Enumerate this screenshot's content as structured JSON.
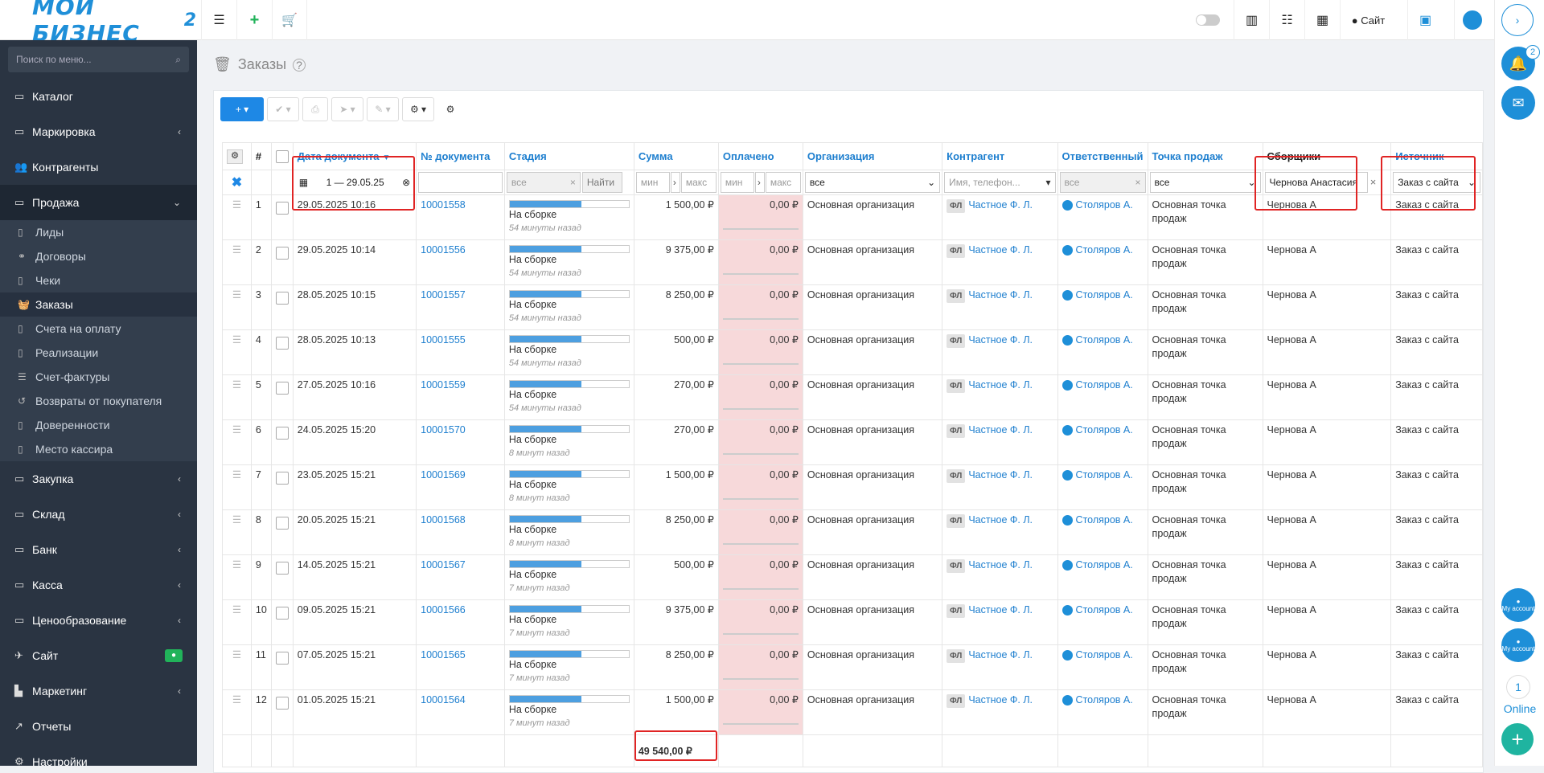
{
  "app": {
    "logo_main": "МОЙ БИЗНЕС",
    "logo_number": "2"
  },
  "topbar": {
    "site_label": "Сайт"
  },
  "sidebar": {
    "search_placeholder": "Поиск по меню...",
    "items": [
      {
        "label": "Каталог",
        "icon": "folder-icon",
        "arrow": false
      },
      {
        "label": "Маркировка",
        "icon": "folder-icon",
        "arrow": true
      },
      {
        "label": "Контрагенты",
        "icon": "users-icon",
        "arrow": false
      },
      {
        "label": "Продажа",
        "icon": "folder-icon",
        "arrow": true,
        "open": true
      }
    ],
    "sub_items": [
      {
        "label": "Лиды",
        "icon": "doc-icon"
      },
      {
        "label": "Договоры",
        "icon": "handshake-icon"
      },
      {
        "label": "Чеки",
        "icon": "doc-icon"
      },
      {
        "label": "Заказы",
        "icon": "basket-icon",
        "active": true
      },
      {
        "label": "Счета на оплату",
        "icon": "doc-icon"
      },
      {
        "label": "Реализации",
        "icon": "doc-icon"
      },
      {
        "label": "Счет-фактуры",
        "icon": "list-icon"
      },
      {
        "label": "Возвраты от покупателя",
        "icon": "undo-icon"
      },
      {
        "label": "Доверенности",
        "icon": "doc-icon"
      },
      {
        "label": "Место кассира",
        "icon": "doc-icon"
      }
    ],
    "items_after": [
      {
        "label": "Закупка",
        "icon": "folder-icon",
        "arrow": true
      },
      {
        "label": "Склад",
        "icon": "folder-icon",
        "arrow": true
      },
      {
        "label": "Банк",
        "icon": "folder-icon",
        "arrow": true
      },
      {
        "label": "Касса",
        "icon": "folder-icon",
        "arrow": true
      },
      {
        "label": "Ценообразование",
        "icon": "folder-icon",
        "arrow": true
      },
      {
        "label": "Сайт",
        "icon": "rocket-icon",
        "badge": true
      },
      {
        "label": "Маркетинг",
        "icon": "chart-icon",
        "arrow": true
      },
      {
        "label": "Отчеты",
        "icon": "line-chart-icon"
      },
      {
        "label": "Настройки",
        "icon": "gear-icon"
      }
    ]
  },
  "page": {
    "title": "Заказы"
  },
  "rightbar": {
    "notify_count": "2",
    "online_count": "1",
    "online_label": "Online",
    "account_label": "My account"
  },
  "table": {
    "columns": [
      "#",
      "Дата документа",
      "№ документа",
      "Стадия",
      "Сумма",
      "Оплачено",
      "Организация",
      "Контрагент",
      "Ответственный",
      "Точка продаж",
      "Сборщики",
      "Источник"
    ],
    "filters": {
      "date": "1 — 29.05.25",
      "stage": "все",
      "find": "Найти",
      "min": "мин",
      "max": "макс",
      "org": "все",
      "contractor_placeholder": "Имя, телефон...",
      "responsible": "все",
      "point": "все",
      "collectors": "Чернова Анастасия",
      "source": "Заказ с сайта"
    },
    "rows": [
      {
        "n": "1",
        "date": "29.05.2025 10:16",
        "doc": "10001558",
        "stage": "На сборке",
        "ago": "54 минуты назад",
        "sum": "1 500,00 ₽",
        "paid": "0,00 ₽",
        "org": "Основная организация",
        "fl": "ФЛ",
        "contractor": "Частное Ф. Л.",
        "resp": "Столяров А.",
        "point": "Основная точка продаж",
        "collector": "Чернова А",
        "source": "Заказ с сайта"
      },
      {
        "n": "2",
        "date": "29.05.2025 10:14",
        "doc": "10001556",
        "stage": "На сборке",
        "ago": "54 минуты назад",
        "sum": "9 375,00 ₽",
        "paid": "0,00 ₽",
        "org": "Основная организация",
        "fl": "ФЛ",
        "contractor": "Частное Ф. Л.",
        "resp": "Столяров А.",
        "point": "Основная точка продаж",
        "collector": "Чернова А",
        "source": "Заказ с сайта"
      },
      {
        "n": "3",
        "date": "28.05.2025 10:15",
        "doc": "10001557",
        "stage": "На сборке",
        "ago": "54 минуты назад",
        "sum": "8 250,00 ₽",
        "paid": "0,00 ₽",
        "org": "Основная организация",
        "fl": "ФЛ",
        "contractor": "Частное Ф. Л.",
        "resp": "Столяров А.",
        "point": "Основная точка продаж",
        "collector": "Чернова А",
        "source": "Заказ с сайта"
      },
      {
        "n": "4",
        "date": "28.05.2025 10:13",
        "doc": "10001555",
        "stage": "На сборке",
        "ago": "54 минуты назад",
        "sum": "500,00 ₽",
        "paid": "0,00 ₽",
        "org": "Основная организация",
        "fl": "ФЛ",
        "contractor": "Частное Ф. Л.",
        "resp": "Столяров А.",
        "point": "Основная точка продаж",
        "collector": "Чернова А",
        "source": "Заказ с сайта"
      },
      {
        "n": "5",
        "date": "27.05.2025 10:16",
        "doc": "10001559",
        "stage": "На сборке",
        "ago": "54 минуты назад",
        "sum": "270,00 ₽",
        "paid": "0,00 ₽",
        "org": "Основная организация",
        "fl": "ФЛ",
        "contractor": "Частное Ф. Л.",
        "resp": "Столяров А.",
        "point": "Основная точка продаж",
        "collector": "Чернова А",
        "source": "Заказ с сайта"
      },
      {
        "n": "6",
        "date": "24.05.2025 15:20",
        "doc": "10001570",
        "stage": "На сборке",
        "ago": "8 минут назад",
        "sum": "270,00 ₽",
        "paid": "0,00 ₽",
        "org": "Основная организация",
        "fl": "ФЛ",
        "contractor": "Частное Ф. Л.",
        "resp": "Столяров А.",
        "point": "Основная точка продаж",
        "collector": "Чернова А",
        "source": "Заказ с сайта"
      },
      {
        "n": "7",
        "date": "23.05.2025 15:21",
        "doc": "10001569",
        "stage": "На сборке",
        "ago": "8 минут назад",
        "sum": "1 500,00 ₽",
        "paid": "0,00 ₽",
        "org": "Основная организация",
        "fl": "ФЛ",
        "contractor": "Частное Ф. Л.",
        "resp": "Столяров А.",
        "point": "Основная точка продаж",
        "collector": "Чернова А",
        "source": "Заказ с сайта"
      },
      {
        "n": "8",
        "date": "20.05.2025 15:21",
        "doc": "10001568",
        "stage": "На сборке",
        "ago": "8 минут назад",
        "sum": "8 250,00 ₽",
        "paid": "0,00 ₽",
        "org": "Основная организация",
        "fl": "ФЛ",
        "contractor": "Частное Ф. Л.",
        "resp": "Столяров А.",
        "point": "Основная точка продаж",
        "collector": "Чернова А",
        "source": "Заказ с сайта"
      },
      {
        "n": "9",
        "date": "14.05.2025 15:21",
        "doc": "10001567",
        "stage": "На сборке",
        "ago": "7 минут назад",
        "sum": "500,00 ₽",
        "paid": "0,00 ₽",
        "org": "Основная организация",
        "fl": "ФЛ",
        "contractor": "Частное Ф. Л.",
        "resp": "Столяров А.",
        "point": "Основная точка продаж",
        "collector": "Чернова А",
        "source": "Заказ с сайта"
      },
      {
        "n": "10",
        "date": "09.05.2025 15:21",
        "doc": "10001566",
        "stage": "На сборке",
        "ago": "7 минут назад",
        "sum": "9 375,00 ₽",
        "paid": "0,00 ₽",
        "org": "Основная организация",
        "fl": "ФЛ",
        "contractor": "Частное Ф. Л.",
        "resp": "Столяров А.",
        "point": "Основная точка продаж",
        "collector": "Чернова А",
        "source": "Заказ с сайта"
      },
      {
        "n": "11",
        "date": "07.05.2025 15:21",
        "doc": "10001565",
        "stage": "На сборке",
        "ago": "7 минут назад",
        "sum": "8 250,00 ₽",
        "paid": "0,00 ₽",
        "org": "Основная организация",
        "fl": "ФЛ",
        "contractor": "Частное Ф. Л.",
        "resp": "Столяров А.",
        "point": "Основная точка продаж",
        "collector": "Чернова А",
        "source": "Заказ с сайта"
      },
      {
        "n": "12",
        "date": "01.05.2025 15:21",
        "doc": "10001564",
        "stage": "На сборке",
        "ago": "7 минут назад",
        "sum": "1 500,00 ₽",
        "paid": "0,00 ₽",
        "org": "Основная организация",
        "fl": "ФЛ",
        "contractor": "Частное Ф. Л.",
        "resp": "Столяров А.",
        "point": "Основная точка продаж",
        "collector": "Чернова А",
        "source": "Заказ с сайта"
      }
    ],
    "total_sum": "49 540,00 ₽",
    "stage_progress": 0.6
  }
}
